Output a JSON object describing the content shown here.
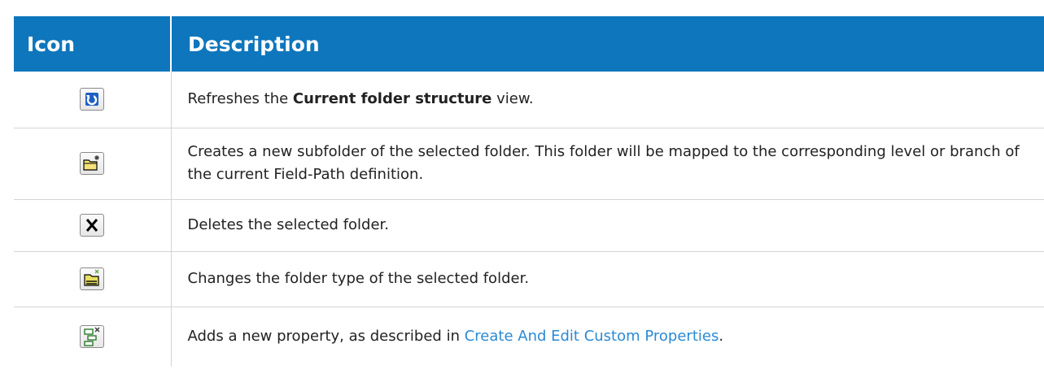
{
  "header": {
    "icon_label": "Icon",
    "description_label": "Description"
  },
  "rows": [
    {
      "icon": "refresh-icon",
      "desc_pre": "Refreshes the ",
      "desc_bold": "Current folder structure",
      "desc_post": " view."
    },
    {
      "icon": "new-subfolder-icon",
      "desc": "Creates a new subfolder of the selected folder. This folder will be mapped to the corresponding level or branch of the current Field-Path definition."
    },
    {
      "icon": "delete-icon",
      "desc": "Deletes the selected folder."
    },
    {
      "icon": "change-folder-type-icon",
      "desc": "Changes the folder type of the selected folder."
    },
    {
      "icon": "add-property-icon",
      "desc_pre": "Adds a new property, as described in ",
      "desc_link": "Create And Edit Custom Properties",
      "desc_post": "."
    }
  ],
  "colors": {
    "header_bg": "#0e76bc",
    "header_text": "#ffffff",
    "link": "#2a8ad4"
  }
}
